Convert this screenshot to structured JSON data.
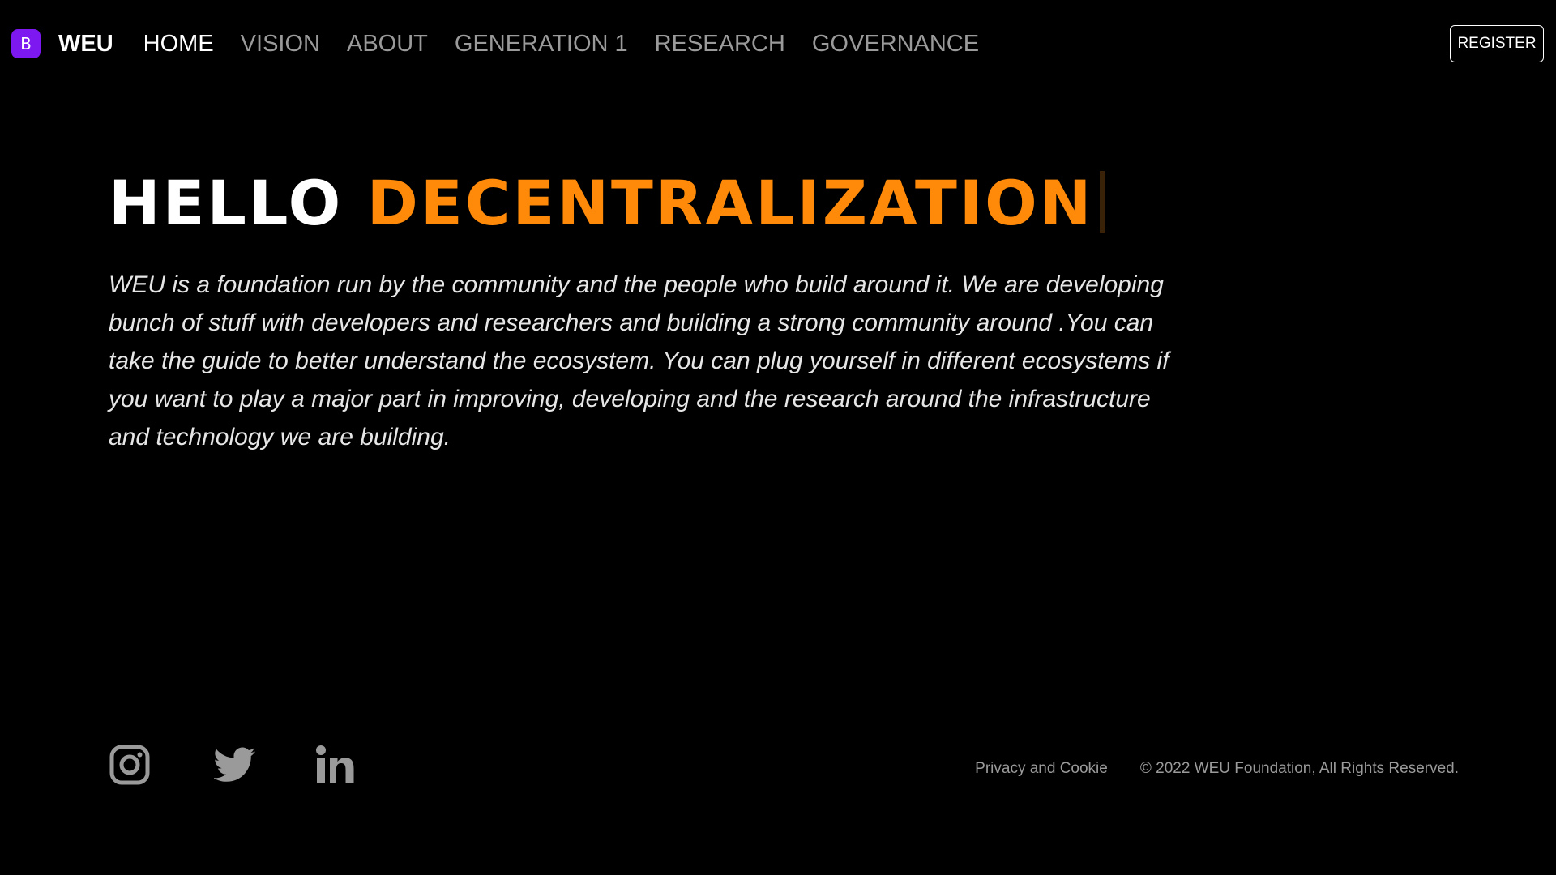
{
  "navbar": {
    "brand_logo_letter": "B",
    "brand_name": "WEU",
    "links": [
      {
        "label": "HOME",
        "active": true
      },
      {
        "label": "VISION",
        "active": false
      },
      {
        "label": "ABOUT",
        "active": false
      },
      {
        "label": "GENERATION 1",
        "active": false
      },
      {
        "label": "RESEARCH",
        "active": false
      },
      {
        "label": "GOVERNANCE",
        "active": false
      }
    ],
    "register_label": "REGISTER"
  },
  "hero": {
    "title_word1": "HELLO",
    "title_word2": "DECENTRALIZATION",
    "description": "WEU is a foundation run by the community and the people who build around it. We are developing bunch of stuff with developers and researchers and building a strong community around .You can take the guide to better understand the ecosystem. You can plug yourself in different ecosystems if you want to play a major part in improving, developing and the research around the infrastructure and technology we are building."
  },
  "footer": {
    "social_icons": [
      "instagram-icon",
      "twitter-icon",
      "linkedin-icon"
    ],
    "privacy_label": "Privacy and Cookie",
    "copyright": "© 2022 WEU Foundation, All Rights Reserved."
  },
  "colors": {
    "background": "#000000",
    "accent": "#ff8a0a",
    "brand_logo": "#7d18f0",
    "nav_inactive": "#9a9a9a",
    "footer_text": "#9a9a9a"
  }
}
